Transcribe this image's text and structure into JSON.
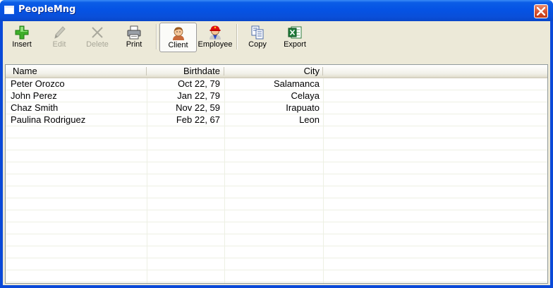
{
  "window": {
    "title": "PeopleMng"
  },
  "toolbar": {
    "insert": "Insert",
    "edit": "Edit",
    "delete": "Delete",
    "print": "Print",
    "client": "Client",
    "employee": "Employee",
    "copy": "Copy",
    "export": "Export"
  },
  "table": {
    "columns": [
      "Name",
      "Birthdate",
      "City"
    ],
    "rows": [
      [
        "Peter Orozco",
        "Oct 22, 79",
        "Salamanca"
      ],
      [
        "John Perez",
        "Jan 22, 79",
        "Celaya"
      ],
      [
        "Chaz Smith",
        "Nov 22, 59",
        "Irapuato"
      ],
      [
        "Paulina Rodriguez",
        "Feb 22, 67",
        "Leon"
      ]
    ]
  }
}
